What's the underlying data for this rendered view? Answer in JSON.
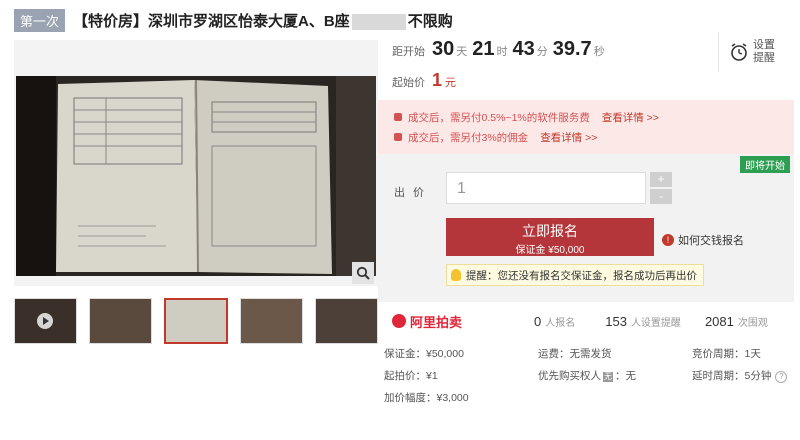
{
  "header": {
    "badge": "第一次",
    "title_prefix": "【特价房】深圳市罗湖区怡泰大厦A、B座",
    "title_suffix": "不限购"
  },
  "gallery": {
    "thumbnails": [
      "thumb-1",
      "thumb-2",
      "thumb-3",
      "thumb-4",
      "thumb-5"
    ],
    "active_index": 2
  },
  "countdown": {
    "label": "距开始",
    "days": "30",
    "days_unit": "天",
    "hours": "21",
    "hours_unit": "时",
    "minutes": "43",
    "minutes_unit": "分",
    "seconds": "39.7",
    "seconds_unit": "秒"
  },
  "reminder": {
    "label": "设置提醒"
  },
  "start_price": {
    "label": "起始价",
    "value": "1",
    "unit": "元"
  },
  "fees": [
    {
      "text": "成交后，需另付0.5%~1%的软件服务费",
      "link": "查看详情 >>"
    },
    {
      "text": "成交后，需另付3%的佣金",
      "link": "查看详情 >>"
    }
  ],
  "bid": {
    "status_badge": "即将开始",
    "label": "出价",
    "value": "1",
    "plus": "+",
    "minus": "-",
    "signup_main": "立即报名",
    "signup_sub": "保证金 ¥50,000",
    "help_link": "如何交钱报名",
    "tip": "提醒：您还没有报名交保证金，报名成功后再出价"
  },
  "stats": {
    "brand": "阿里拍卖",
    "signups": "0",
    "signups_label": "人报名",
    "reminders": "153",
    "reminders_label": "人设置提醒",
    "views": "2081",
    "views_label": "次围观"
  },
  "info": {
    "deposit": "保证金：¥50,000",
    "shipping": "运费：无需发货",
    "cycle": "竞价周期：1天",
    "start": "起拍价：¥1",
    "priority_a": "优先购买权人",
    "priority_badge": "无",
    "priority_b": "：无",
    "delay": "延时周期：5分钟",
    "increment": "加价幅度：¥3,000"
  },
  "colors": {
    "accent": "#b5363a",
    "fee_bg": "#fde8e8",
    "badge_green": "#2e9e52"
  }
}
